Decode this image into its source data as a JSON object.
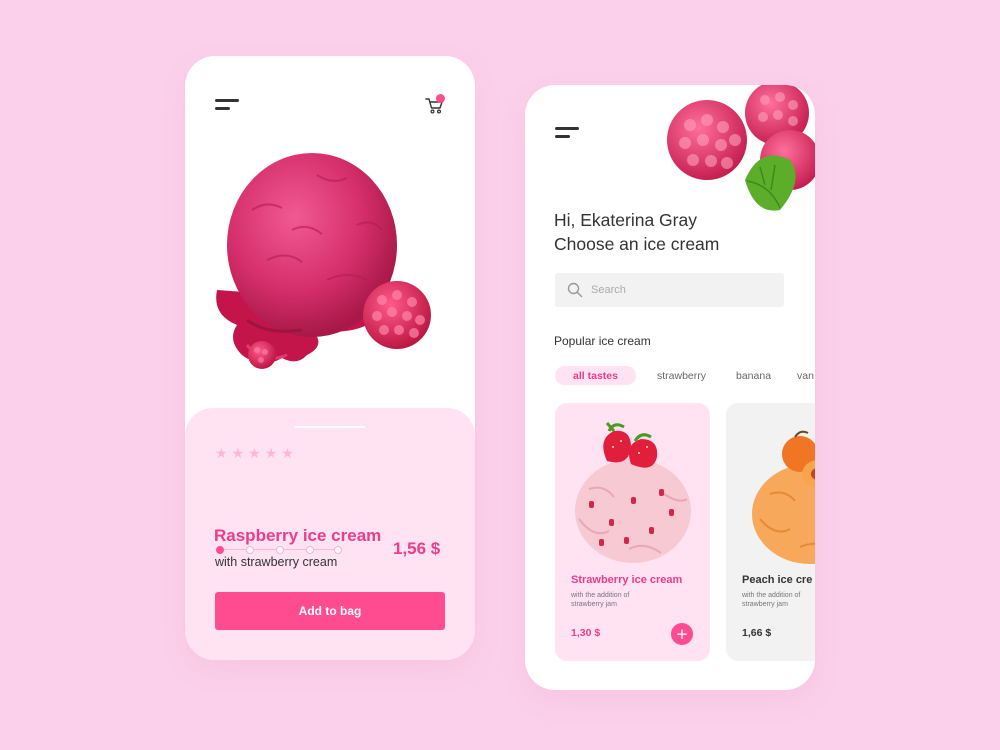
{
  "product_screen": {
    "rating_stars": [
      "★",
      "★",
      "★",
      "★",
      "★"
    ],
    "title": "Raspberry ice cream",
    "subtitle": "with strawberry cream",
    "price": "1,56 $",
    "size_selected_index": 0,
    "size_option_count": 5,
    "add_button_label": "Add to bag",
    "icons": {
      "menu": "menu-icon",
      "cart": "cart-icon",
      "cart_badge": "cart-badge"
    }
  },
  "catalog_screen": {
    "greeting_line1": "Hi, Ekaterina Gray",
    "greeting_line2": "Choose an ice cream",
    "search": {
      "placeholder": "Search",
      "icon": "search-icon"
    },
    "section_title": "Popular ice cream",
    "categories": [
      {
        "label": "all tastes",
        "active": true
      },
      {
        "label": "strawberry",
        "active": false
      },
      {
        "label": "banana",
        "active": false
      },
      {
        "label": "van",
        "active": false
      }
    ],
    "products": [
      {
        "name": "Strawberry ice cream",
        "description": "with the addition of strawberry jam",
        "price": "1,30 $",
        "add_icon": "+"
      },
      {
        "name": "Peach  ice cre",
        "description": "with the addition of strawberry jam",
        "price": "1,66 $"
      }
    ]
  },
  "colors": {
    "background": "#fbd0ea",
    "accent": "#ff4b8f",
    "accent_text": "#ea3d8b",
    "panel_pink": "#ffe3f2",
    "card_grey": "#f2f2f2"
  }
}
